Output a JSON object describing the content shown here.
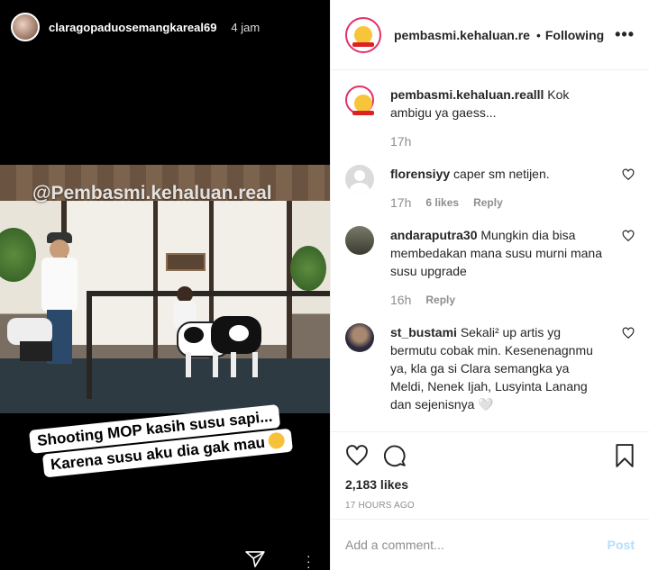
{
  "story": {
    "username": "claragopaduosemangkareal69",
    "time": "4 jam",
    "watermark": "@Pembasmi.kehaluan.real",
    "caption_line1": "Shooting MOP kasih susu sapi...",
    "caption_line2": "Karena susu aku dia gak mau"
  },
  "header": {
    "username": "pembasmi.kehaluan.re",
    "dot": "•",
    "following": "Following",
    "more": "•••"
  },
  "comments": [
    {
      "user": "pembasmi.kehaluan.realll",
      "text": "Kok ambigu ya gaess...",
      "time": "17h",
      "likes": "",
      "reply": ""
    },
    {
      "user": "florensiyy",
      "text": "caper sm netijen.",
      "time": "17h",
      "likes": "6 likes",
      "reply": "Reply"
    },
    {
      "user": "andaraputra30",
      "text": "Mungkin dia bisa membedakan mana susu murni mana susu upgrade",
      "time": "16h",
      "likes": "",
      "reply": "Reply"
    },
    {
      "user": "st_bustami",
      "text": "Sekali² up artis yg bermutu cobak min. Kesenenagnmu ya, kla ga si Clara semangka ya Meldi, Nenek Ijah, Lusyinta Lanang dan sejenisnya 🤍",
      "time": "",
      "likes": "",
      "reply": ""
    }
  ],
  "post": {
    "likes": "2,183 likes",
    "age": "17 HOURS AGO"
  },
  "composer": {
    "placeholder": "Add a comment...",
    "post_label": "Post"
  },
  "colors": {
    "link_disabled": "#b2dffc",
    "text": "#262626",
    "muted": "#8e8e8e",
    "border": "#efefef"
  }
}
